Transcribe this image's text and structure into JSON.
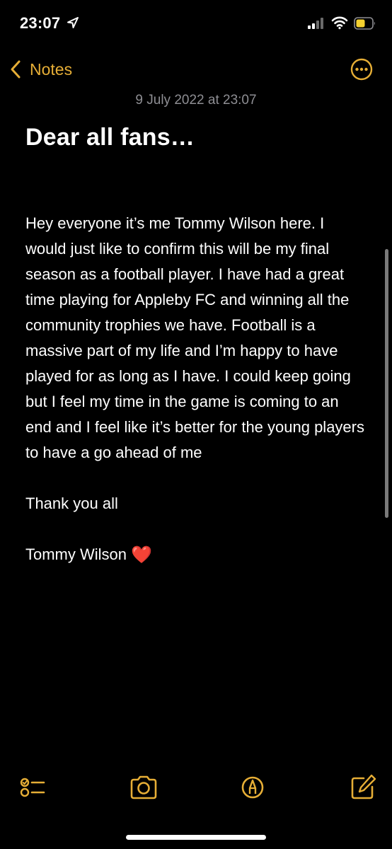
{
  "status_bar": {
    "time": "23:07",
    "location_icon": "location-arrow-icon",
    "signal_icon": "cellular-signal-icon",
    "wifi_icon": "wifi-icon",
    "battery_icon": "battery-icon",
    "battery_color": "#F5D130"
  },
  "nav": {
    "back_label": "Notes",
    "back_icon": "chevron-left-icon",
    "more_icon": "ellipsis-circle-icon",
    "accent_color": "#E6AE36"
  },
  "note": {
    "date": "9 July 2022 at 23:07",
    "title": "Dear all fans…",
    "paragraphs": [
      "Hey everyone it’s me Tommy Wilson here. I would just like to confirm this will be my final season as a football player. I have had a great time playing for Appleby FC and winning all the community trophies we have. Football is a massive part of my life and I’m happy to have played for as long as I have. I could keep going but I feel my time in the game is coming to an end and I feel like it’s better for the young players to have a go ahead of me",
      "Thank you all"
    ],
    "signature": "Tommy Wilson",
    "signature_emoji": "❤️"
  },
  "toolbar": {
    "checklist_icon": "checklist-icon",
    "camera_icon": "camera-icon",
    "markup_icon": "pen-markup-icon",
    "compose_icon": "compose-icon"
  }
}
